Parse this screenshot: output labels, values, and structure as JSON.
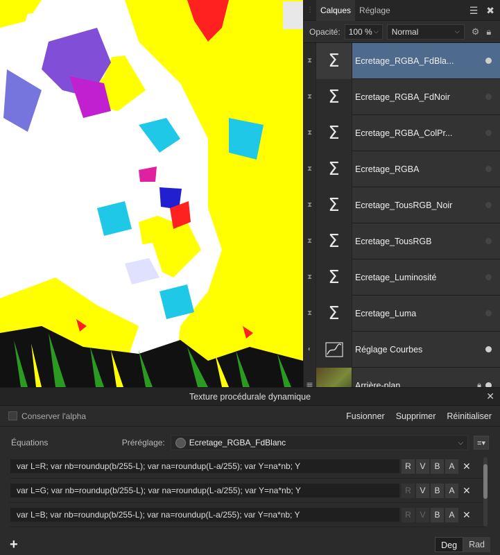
{
  "panel": {
    "tabs": [
      "Calques",
      "Réglage"
    ],
    "opacity_label": "Opacité:",
    "opacity_value": "100 %",
    "blend_mode": "Normal"
  },
  "layers": [
    {
      "name": "Ecretage_RGBA_FdBla...",
      "icon": "Σ",
      "selected": true
    },
    {
      "name": "Ecretage_RGBA_FdNoir",
      "icon": "Σ"
    },
    {
      "name": "Ecretage_RGBA_ColPr...",
      "icon": "Σ"
    },
    {
      "name": "Ecretage_RGBA",
      "icon": "Σ"
    },
    {
      "name": "Ecretage_TousRGB_Noir",
      "icon": "Σ"
    },
    {
      "name": "Ecretage_TousRGB",
      "icon": "Σ"
    },
    {
      "name": "Ecretage_Luminosité",
      "icon": "Σ"
    },
    {
      "name": "Ecretage_Luma",
      "icon": "Σ"
    },
    {
      "name": "Réglage Courbes",
      "icon": "curves"
    },
    {
      "name": "Arrière-plan",
      "icon": "photo",
      "locked": true
    }
  ],
  "dialog": {
    "title": "Texture procédurale dynamique",
    "preserve_alpha_label": "Conserver l'alpha",
    "merge_label": "Fusionner",
    "delete_label": "Supprimer",
    "reset_label": "Réinitialiser",
    "equations_label": "Équations",
    "preset_label": "Préréglage:",
    "preset_value": "Ecretage_RGBA_FdBlanc",
    "equations": [
      {
        "text": "var L=R; var nb=roundup(b/255-L); var na=roundup(L-a/255); var Y=na*nb;  Y",
        "channels": [
          "R",
          "V",
          "B",
          "A"
        ],
        "active": [
          true,
          true,
          true,
          true
        ]
      },
      {
        "text": "var L=G; var nb=roundup(b/255-L); var na=roundup(L-a/255); var Y=na*nb;  Y",
        "channels": [
          "R",
          "V",
          "B",
          "A"
        ],
        "active": [
          false,
          true,
          true,
          true
        ]
      },
      {
        "text": "var L=B; var nb=roundup(b/255-L); var na=roundup(L-a/255); var Y=na*nb;  Y",
        "channels": [
          "R",
          "V",
          "B",
          "A"
        ],
        "active": [
          false,
          false,
          true,
          true
        ]
      }
    ],
    "deg_label": "Deg",
    "rad_label": "Rad"
  }
}
